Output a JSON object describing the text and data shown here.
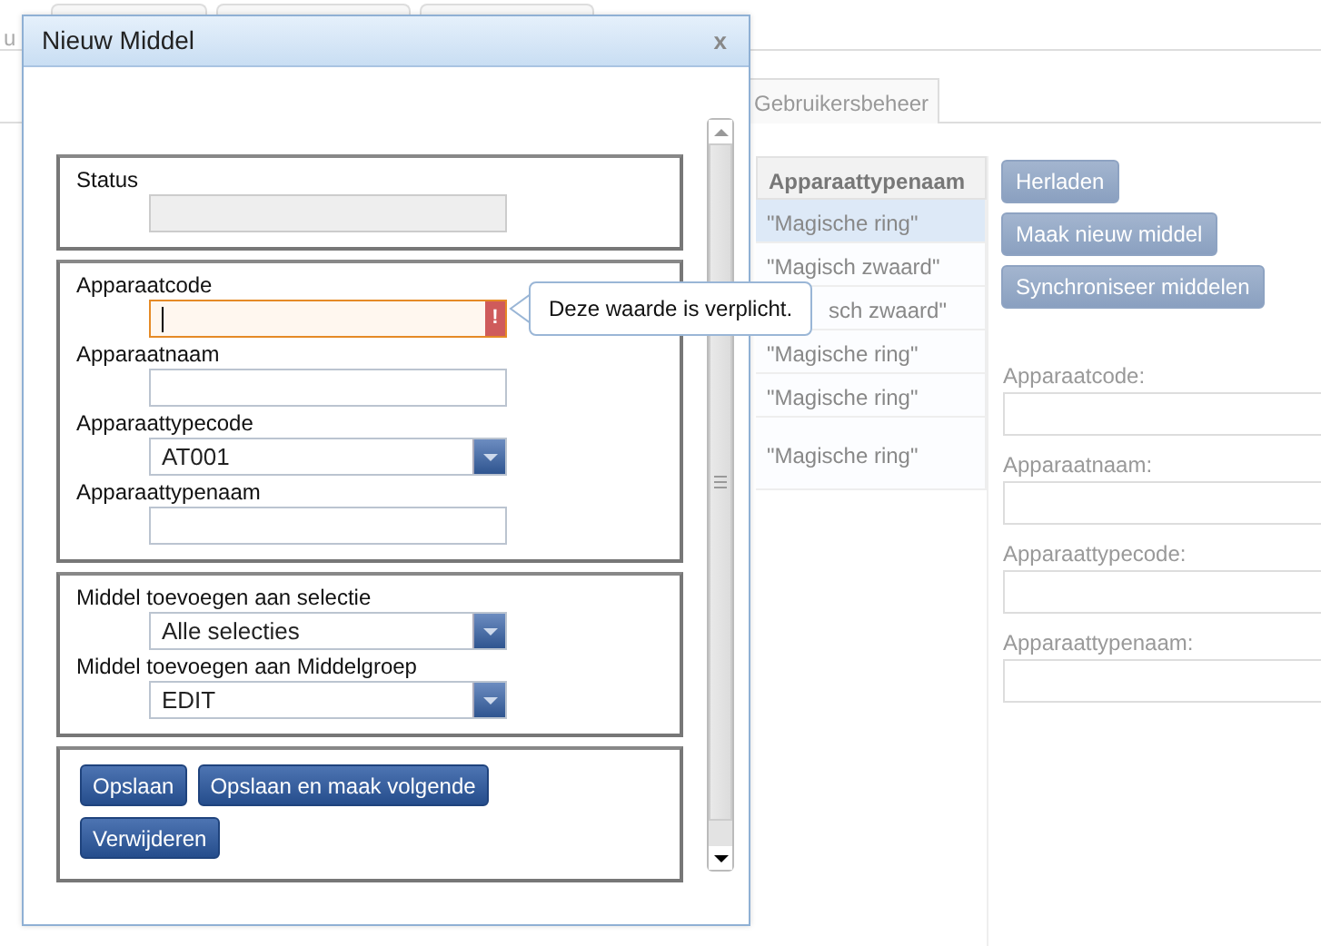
{
  "background": {
    "fragments": [
      {
        "kind": "top",
        "text": "u"
      }
    ],
    "tabs": [
      {
        "label": "Gebruikersbeheer",
        "selected": false
      }
    ],
    "table": {
      "columns": [
        "Apparaattypenaam"
      ],
      "rows": [
        {
          "cells": [
            "\"Magische ring\""
          ],
          "selected": true
        },
        {
          "cells": [
            "\"Magisch zwaard\""
          ],
          "selected": false
        },
        {
          "cells": [
            "sch zwaard\""
          ],
          "selected": false
        },
        {
          "cells": [
            "\"Magische ring\""
          ],
          "selected": false
        },
        {
          "cells": [
            "\"Magische ring\""
          ],
          "selected": false
        },
        {
          "cells": [
            "\"Magische ring\""
          ],
          "selected": false
        }
      ]
    },
    "buttons": [
      "Herladen",
      "Maak nieuw middel",
      "Synchroniseer middelen"
    ],
    "form": [
      "Apparaatcode:",
      "Apparaatnaam:",
      "Apparaattypecode:",
      "Apparaattypenaam:"
    ]
  },
  "dialog": {
    "title": "Nieuw Middel",
    "close": "x",
    "sections": [
      {
        "fields": [
          {
            "label": "Status",
            "kind": "text",
            "disabled": true
          }
        ]
      },
      {
        "fields": [
          {
            "label": "Apparaatcode",
            "kind": "text",
            "invalid": true,
            "focused": true,
            "error_mark": "!"
          },
          {
            "label": "Apparaatnaam",
            "kind": "text"
          },
          {
            "label": "Apparaattypecode",
            "kind": "select",
            "value": "AT001"
          },
          {
            "label": "Apparaattypenaam",
            "kind": "text"
          }
        ]
      },
      {
        "fields": [
          {
            "label": "Middel toevoegen aan selectie",
            "kind": "select",
            "value": "Alle selecties"
          },
          {
            "label": "Middel toevoegen aan Middelgroep",
            "kind": "select",
            "value": "EDIT"
          }
        ]
      }
    ],
    "buttons": [
      "Opslaan",
      "Opslaan en maak volgende",
      "Verwijderen"
    ],
    "tooltip": "Deze waarde is verplicht."
  }
}
